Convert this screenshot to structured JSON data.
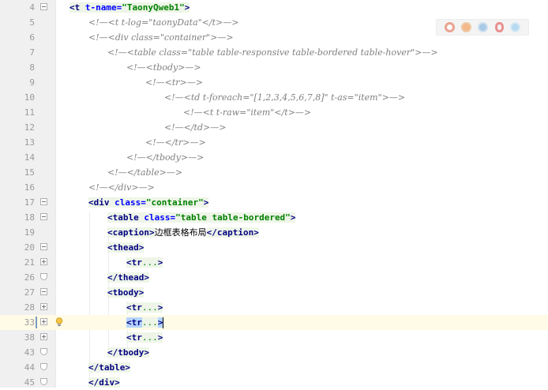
{
  "browser_icons": [
    {
      "name": "chrome-icon",
      "color": "#e07a5f"
    },
    {
      "name": "firefox-icon",
      "color": "#f2a65a"
    },
    {
      "name": "safari-icon",
      "color": "#6fa8dc"
    },
    {
      "name": "opera-icon",
      "color": "#e06666"
    },
    {
      "name": "ie-icon",
      "color": "#8ec5e8"
    }
  ],
  "lines": {
    "l4": {
      "num": "4",
      "t1": "<t ",
      "a1": "t-name=",
      "s1": "\"TaonyQweb1\"",
      "t2": ">"
    },
    "l5": {
      "num": "5",
      "cm": "<!—<t t-log=\"taonyData\"</t>—>"
    },
    "l6": {
      "num": "6",
      "cm": "<!—<div class=\"container\">—>"
    },
    "l7": {
      "num": "7",
      "cm": "<!—<table class=\"table table-responsive table-bordered table-hover\">—>"
    },
    "l8": {
      "num": "8",
      "cm": "<!—<tbody>—>"
    },
    "l9": {
      "num": "9",
      "cm": "<!—<tr>—>"
    },
    "l10": {
      "num": "10",
      "cm": "<!—<td t-foreach=\"[1,2,3,4,5,6,7,8]\" t-as=\"item\">—>"
    },
    "l11": {
      "num": "11",
      "cm": "<!—<t t-raw=\"item\"</t>—>"
    },
    "l12": {
      "num": "12",
      "cm": "<!—</td>—>"
    },
    "l13": {
      "num": "13",
      "cm": "<!—</tr>—>"
    },
    "l14": {
      "num": "14",
      "cm": "<!—</tbody>—>"
    },
    "l15": {
      "num": "15",
      "cm": "<!—</table>—>"
    },
    "l16": {
      "num": "16",
      "cm": "<!—</div>—>"
    },
    "l17": {
      "num": "17",
      "t1": "<div ",
      "a1": "class=",
      "s1": "\"container\"",
      "t2": ">"
    },
    "l18": {
      "num": "18",
      "t1": "<table ",
      "a1": "class=",
      "s1": "\"table table-bordered\"",
      "t2": ">"
    },
    "l19": {
      "num": "19",
      "t1": "<caption>",
      "txt": "边框表格布局",
      "t2": "</caption>"
    },
    "l20": {
      "num": "20",
      "t1": "<thead>"
    },
    "l21": {
      "num": "21",
      "t1": "<tr",
      "fold": "...",
      "t2": ">"
    },
    "l26": {
      "num": "26",
      "t1": "</thead>"
    },
    "l27": {
      "num": "27",
      "t1": "<tbody>"
    },
    "l28": {
      "num": "28",
      "t1": "<tr",
      "fold": "...",
      "t2": ">"
    },
    "l33": {
      "num": "33",
      "t1": "<tr",
      "fold": "...",
      "t2": ">"
    },
    "l38": {
      "num": "38",
      "t1": "<tr",
      "fold": "...",
      "t2": ">"
    },
    "l43": {
      "num": "43",
      "t1": "</tbody>"
    },
    "l44": {
      "num": "44",
      "t1": "</table>"
    },
    "l45": {
      "num": "45",
      "t1": "</div>"
    }
  }
}
